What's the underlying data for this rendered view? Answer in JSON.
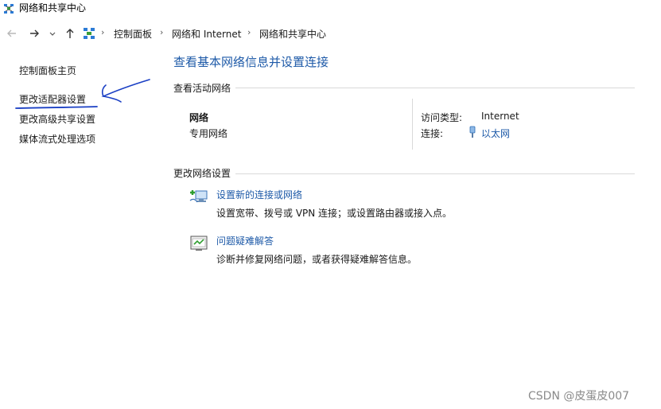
{
  "window": {
    "title": "网络和共享中心"
  },
  "breadcrumb": [
    "控制面板",
    "网络和 Internet",
    "网络和共享中心"
  ],
  "sidebar": {
    "items": [
      {
        "label": "控制面板主页"
      },
      {
        "label": "更改适配器设置"
      },
      {
        "label": "更改高级共享设置"
      },
      {
        "label": "媒体流式处理选项"
      }
    ]
  },
  "main": {
    "title": "查看基本网络信息并设置连接",
    "active_networks_heading": "查看活动网络",
    "network": {
      "name": "网络",
      "type": "专用网络",
      "access_type_label": "访问类型:",
      "access_type_value": "Internet",
      "connections_label": "连接:",
      "connection_value": "以太网"
    },
    "change_settings_heading": "更改网络设置",
    "tasks": [
      {
        "link": "设置新的连接或网络",
        "description": "设置宽带、拨号或 VPN 连接；或设置路由器或接入点。",
        "icon": "network-setup-icon"
      },
      {
        "link": "问题疑难解答",
        "description": "诊断并修复网络问题，或者获得疑难解答信息。",
        "icon": "troubleshoot-icon"
      }
    ]
  },
  "colors": {
    "link": "#1e5aa8",
    "annotation": "#1a3fc4"
  },
  "watermark": "CSDN @皮蛋皮007"
}
